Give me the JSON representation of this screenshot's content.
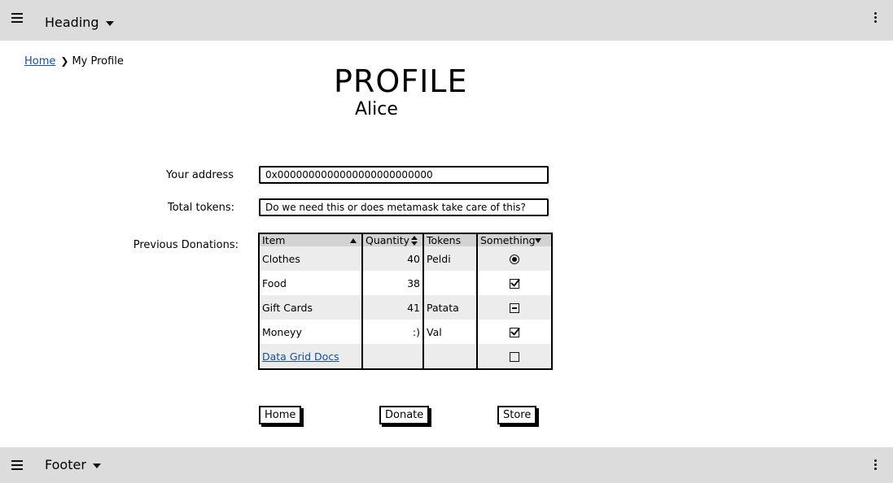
{
  "header": {
    "title": "Heading"
  },
  "footer": {
    "title": "Footer"
  },
  "breadcrumb": {
    "home": "Home",
    "current": "My Profile"
  },
  "profile": {
    "title": "PROFILE",
    "name": "Alice"
  },
  "form": {
    "address_label": "Your address",
    "address_value": "0x0000000000000000000000000",
    "tokens_label": "Total tokens:",
    "tokens_value": "Do we need this or does metamask take care of this?",
    "donations_label": "Previous Donations:"
  },
  "grid": {
    "columns": [
      "Item",
      "Quantity",
      "Tokens",
      "Something"
    ],
    "rows": [
      {
        "item": "Clothes",
        "quantity": "40",
        "tokens": "Peldi",
        "something": "radio-selected"
      },
      {
        "item": "Food",
        "quantity": "38",
        "tokens": "",
        "something": "checkbox-checked"
      },
      {
        "item": "Gift Cards",
        "quantity": "41",
        "tokens": "Patata",
        "something": "checkbox-indeterminate"
      },
      {
        "item": "Moneyy",
        "quantity": ":)",
        "tokens": "Val",
        "something": "checkbox-checked"
      },
      {
        "item": "Data Grid Docs",
        "quantity": "",
        "tokens": "",
        "something": "checkbox-unchecked"
      }
    ]
  },
  "buttons": {
    "home": "Home",
    "donate": "Donate",
    "store": "Store"
  },
  "colors": {
    "bar_bg": "#dcdcdc",
    "link": "#1a4f8b",
    "header_row": "#d2d2d2",
    "alt_row": "#ececec"
  }
}
